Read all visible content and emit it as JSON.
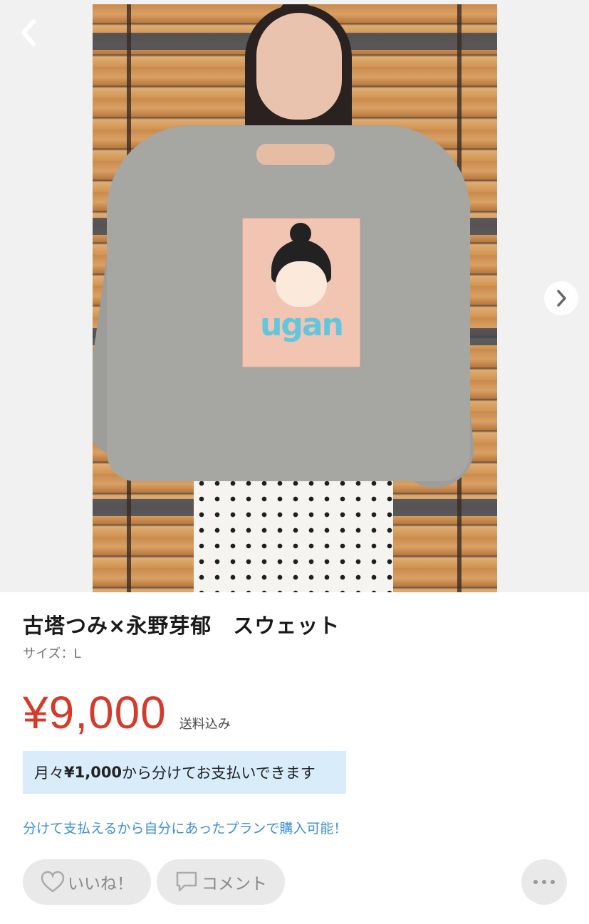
{
  "gallery": {
    "image_alt": "古塔つみ×永野芽郁 スウェット",
    "print_text": "ugan"
  },
  "nav": {
    "back_icon": "chevron-left-icon",
    "next_icon": "chevron-right-icon"
  },
  "product": {
    "title": "古塔つみ×永野芽郁　スウェット",
    "size_label": "サイズ：L",
    "price": "¥9,000",
    "shipping": "送料込み",
    "price_color": "#d33b2c"
  },
  "installment": {
    "prefix": "月々",
    "amount": "¥1,000",
    "suffix": "から分けてお支払いできます",
    "bg_color": "#d9ecfa"
  },
  "plan_link": {
    "text": "分けて支払えるから自分にあったプランで購入可能！",
    "color": "#3d8fd0"
  },
  "actions": {
    "like_label": "いいね！",
    "comment_label": "コメント",
    "like_icon": "heart-icon",
    "comment_icon": "speech-bubble-icon",
    "more_icon": "more-dots-icon"
  }
}
